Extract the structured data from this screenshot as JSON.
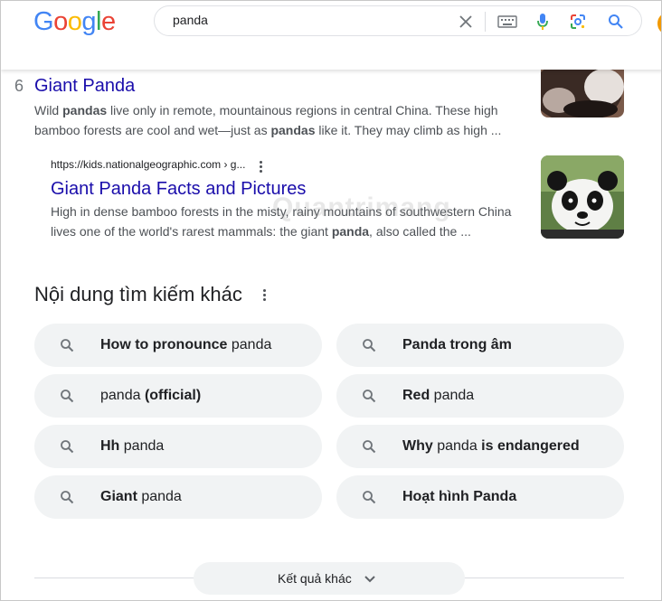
{
  "logo": {
    "letters": [
      "G",
      "o",
      "o",
      "g",
      "l",
      "e"
    ],
    "colors": [
      "#4285f4",
      "#ea4335",
      "#fbbc05",
      "#4285f4",
      "#34a853",
      "#ea4335"
    ]
  },
  "search": {
    "query": "panda"
  },
  "icons": {
    "clear": "close-icon",
    "keyboard": "keyboard-icon",
    "voice": "microphone-icon",
    "lens": "google-lens-icon",
    "search": "search-icon"
  },
  "result_top": {
    "number": "6",
    "title": "Giant Panda",
    "snippet_line1": [
      "Wild ",
      "pandas",
      " live only in remote, mountainous regions in central China. These high"
    ],
    "snippet_line2": [
      "bamboo forests are cool and wet—just as ",
      "pandas",
      " like it. They may climb as high ..."
    ]
  },
  "result_sub": {
    "url": "https://kids.nationalgeographic.com › g...",
    "title": "Giant Panda Facts and Pictures",
    "snippet_line1": "High in dense bamboo forests in the misty, rainy mountains of southwestern China",
    "snippet_line2": [
      "lives one of the world's rarest mammals: the giant ",
      "panda",
      ", also called the ..."
    ]
  },
  "related": {
    "heading": "Nội dung tìm kiếm khác",
    "items": [
      {
        "bold": "How to pronounce",
        "normal": " panda",
        "bold2": ""
      },
      {
        "bold": "Panda trong âm",
        "normal": "",
        "bold2": ""
      },
      {
        "bold": "",
        "normal": "panda ",
        "bold2": "(official)"
      },
      {
        "bold": "Red",
        "normal": " panda",
        "bold2": ""
      },
      {
        "bold": "Hh",
        "normal": " panda",
        "bold2": ""
      },
      {
        "bold": "Why",
        "normal": " panda ",
        "bold2": "is endangered"
      },
      {
        "bold": "Giant",
        "normal": " panda",
        "bold2": ""
      },
      {
        "bold": "Hoạt hình Panda",
        "normal": "",
        "bold2": ""
      }
    ]
  },
  "more_results": {
    "label": "Kết quả khác"
  },
  "watermark": "Quantrimang"
}
